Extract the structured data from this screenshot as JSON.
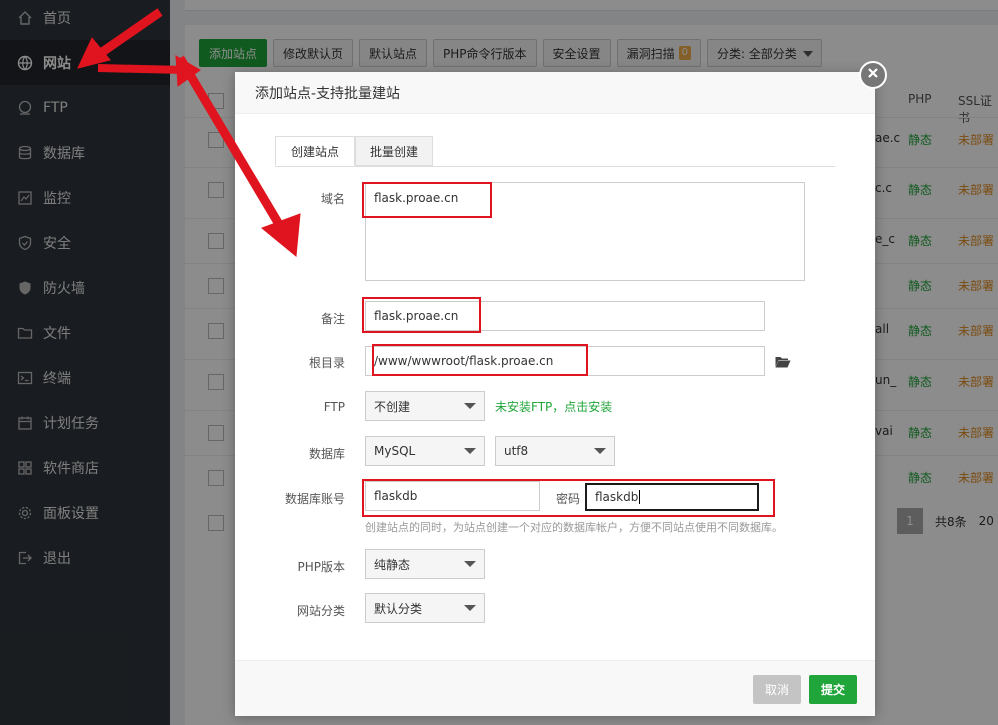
{
  "sidebar": {
    "items": [
      {
        "label": "首页",
        "icon": "home-icon"
      },
      {
        "label": "网站",
        "icon": "globe-icon"
      },
      {
        "label": "FTP",
        "icon": "ftp-icon"
      },
      {
        "label": "数据库",
        "icon": "database-icon"
      },
      {
        "label": "监控",
        "icon": "monitor-icon"
      },
      {
        "label": "安全",
        "icon": "shield-icon"
      },
      {
        "label": "防火墙",
        "icon": "firewall-icon"
      },
      {
        "label": "文件",
        "icon": "folder-icon"
      },
      {
        "label": "终端",
        "icon": "terminal-icon"
      },
      {
        "label": "计划任务",
        "icon": "calendar-icon"
      },
      {
        "label": "软件商店",
        "icon": "apps-icon"
      },
      {
        "label": "面板设置",
        "icon": "gear-icon"
      },
      {
        "label": "退出",
        "icon": "logout-icon"
      }
    ],
    "active_index": 1
  },
  "toolbar": {
    "add_site": "添加站点",
    "modify_default_page": "修改默认页",
    "default_site": "默认站点",
    "php_cli_version": "PHP命令行版本",
    "security_settings": "安全设置",
    "vuln_scan": "漏洞扫描",
    "vuln_count": "0",
    "category": "分类: 全部分类"
  },
  "table": {
    "headers": {
      "php": "PHP",
      "ssl": "SSL证书"
    },
    "rows": [
      {
        "frag": "ae.c",
        "php": "静态",
        "ssl": "未部署"
      },
      {
        "frag": "c.c",
        "php": "静态",
        "ssl": "未部署"
      },
      {
        "frag": "e_c",
        "php": "静态",
        "ssl": "未部署"
      },
      {
        "frag": "",
        "php": "静态",
        "ssl": "未部署"
      },
      {
        "frag": "all",
        "php": "静态",
        "ssl": "未部署"
      },
      {
        "frag": "un_",
        "php": "静态",
        "ssl": "未部署"
      },
      {
        "frag": "vai",
        "php": "静态",
        "ssl": "未部署"
      },
      {
        "frag": "",
        "php": "静态",
        "ssl": "未部署"
      }
    ],
    "pager": {
      "current": "1",
      "total": "共8条",
      "per": "20"
    }
  },
  "dialog": {
    "title": "添加站点-支持批量建站",
    "tabs": [
      "创建站点",
      "批量创建"
    ],
    "fields": {
      "domain_label": "域名",
      "domain_value": "flask.proae.cn",
      "remark_label": "备注",
      "remark_value": "flask.proae.cn",
      "root_label": "根目录",
      "root_value": "/www/wwwroot/flask.proae.cn",
      "ftp_label": "FTP",
      "ftp_value": "不创建",
      "ftp_hint": "未安装FTP，点击安装",
      "db_label": "数据库",
      "db_type": "MySQL",
      "db_charset": "utf8",
      "db_user_label": "数据库账号",
      "db_user_value": "flaskdb",
      "db_pass_label": "密码",
      "db_pass_value": "flaskdb",
      "db_hint": "创建站点的同时，为站点创建一个对应的数据库帐户，方便不同站点使用不同数据库。",
      "php_label": "PHP版本",
      "php_value": "纯静态",
      "category_label": "网站分类",
      "category_value": "默认分类"
    },
    "buttons": {
      "cancel": "取消",
      "submit": "提交"
    }
  },
  "colors": {
    "accent": "#20a53a",
    "annotation": "#e0141e",
    "sidebar": "#2f343b"
  }
}
